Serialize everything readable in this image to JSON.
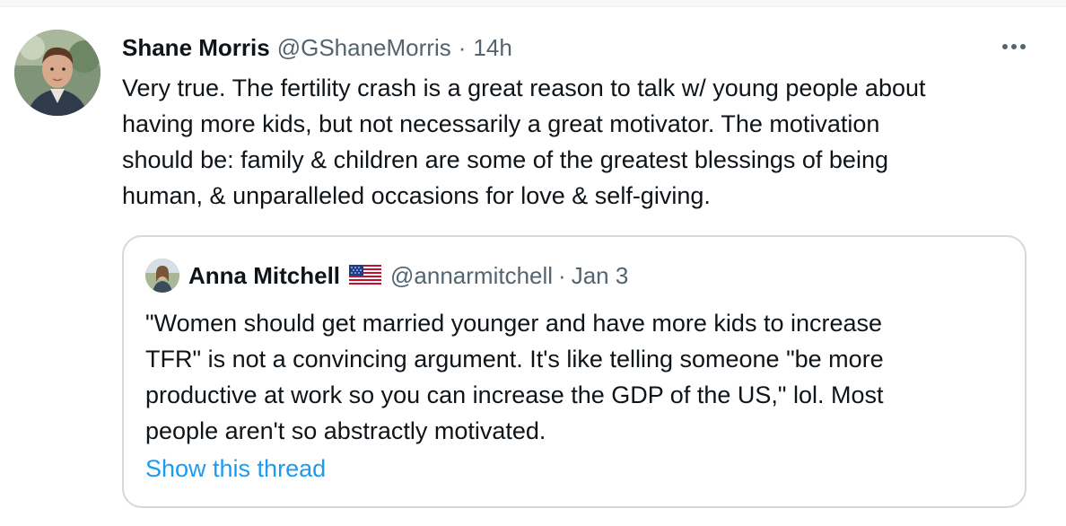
{
  "tweet": {
    "author_name": "Shane Morris",
    "author_handle": "@GShaneMorris",
    "separator": "·",
    "timestamp": "14h",
    "more_icon": "more-horizontal-icon",
    "text_lines": [
      "Very true. The fertility crash is a great reason to talk w/ young people about",
      "having more kids, but not necessarily a great motivator. The motivation",
      "should be: family & children are some of the greatest blessings of being",
      "human, & unparalleled occasions for love & self-giving."
    ]
  },
  "quote": {
    "author_name": "Anna Mitchell",
    "flag_icon": "us-flag-icon",
    "author_handle": "@annarmitchell",
    "separator": "·",
    "timestamp": "Jan 3",
    "text_lines": [
      "\"Women should get married younger and have more kids to increase",
      "TFR\" is not a convincing argument. It's like telling someone \"be more",
      "productive at work so you can increase the GDP of the US,\" lol. Most",
      "people aren't so abstractly motivated."
    ],
    "show_thread_label": "Show this thread"
  },
  "colors": {
    "text_primary": "#0f1419",
    "text_secondary": "#536471",
    "link": "#1d9bf0",
    "border": "#cfd9de"
  }
}
